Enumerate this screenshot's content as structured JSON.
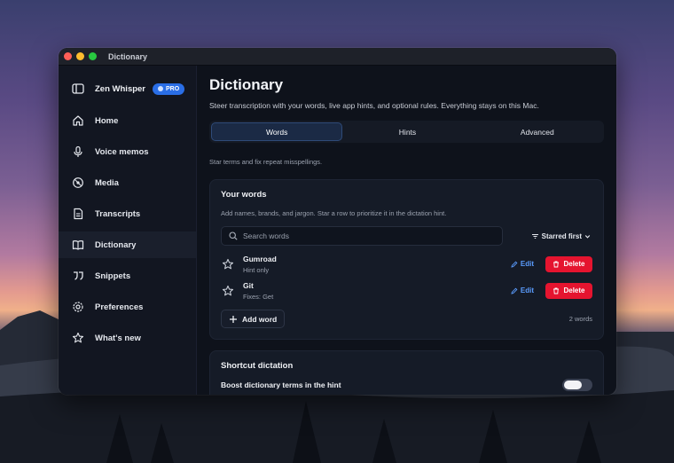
{
  "window": {
    "title": "Dictionary"
  },
  "sidebar": {
    "brand": "Zen Whisper",
    "badge": "PRO",
    "items": [
      {
        "label": "Home",
        "icon": "home-icon"
      },
      {
        "label": "Voice memos",
        "icon": "microphone-icon"
      },
      {
        "label": "Media",
        "icon": "media-icon"
      },
      {
        "label": "Transcripts",
        "icon": "document-icon"
      },
      {
        "label": "Dictionary",
        "icon": "book-icon",
        "active": true
      },
      {
        "label": "Snippets",
        "icon": "quote-icon"
      },
      {
        "label": "Preferences",
        "icon": "gear-icon"
      },
      {
        "label": "What's new",
        "icon": "star-icon"
      }
    ]
  },
  "main": {
    "title": "Dictionary",
    "subtitle": "Steer transcription with your words, live app hints, and optional rules. Everything stays on this Mac.",
    "tabs": [
      {
        "label": "Words",
        "active": true
      },
      {
        "label": "Hints"
      },
      {
        "label": "Advanced"
      }
    ],
    "hint": "Star terms and fix repeat misspellings.",
    "your_words": {
      "title": "Your words",
      "description": "Add names, brands, and jargon. Star a row to prioritize it in the dictation hint.",
      "search_placeholder": "Search words",
      "sort_label": "Starred first",
      "rows": [
        {
          "word": "Gumroad",
          "meta": "Hint only",
          "edit": "Edit",
          "delete": "Delete"
        },
        {
          "word": "Git",
          "meta": "Fixes: Get",
          "edit": "Edit",
          "delete": "Delete"
        }
      ],
      "add_label": "Add word",
      "count": "2 words"
    },
    "shortcut": {
      "title": "Shortcut dictation",
      "toggle_label": "Boost dictionary terms in the hint",
      "toggle_on": false
    }
  },
  "colors": {
    "accent": "#2a6ee6",
    "delete": "#e5142f",
    "edit": "#5b9dff",
    "window_bg": "#0e121b"
  }
}
